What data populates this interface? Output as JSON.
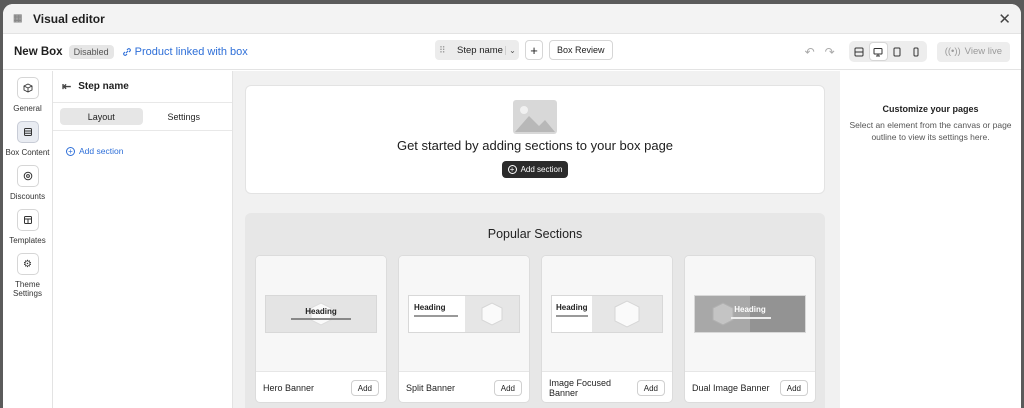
{
  "window": {
    "title": "Visual editor"
  },
  "toolbar": {
    "box_name": "New Box",
    "status_badge": "Disabled",
    "product_link": "Product linked with box",
    "step_select": "Step name",
    "box_review": "Box Review",
    "view_live": "View live"
  },
  "rail": [
    {
      "label": "General",
      "icon": "box-icon"
    },
    {
      "label": "Box Content",
      "icon": "layers-icon",
      "active": true
    },
    {
      "label": "Discounts",
      "icon": "discount-icon"
    },
    {
      "label": "Templates",
      "icon": "template-icon"
    },
    {
      "label": "Theme Settings",
      "icon": "gear-icon"
    }
  ],
  "left_panel": {
    "title": "Step name",
    "tabs": [
      "Layout",
      "Settings"
    ],
    "add_section": "Add section"
  },
  "canvas": {
    "empty_title": "Get started by adding sections to your box page",
    "empty_button": "Add section",
    "popular_title": "Popular Sections",
    "cards": [
      {
        "name": "Hero Banner",
        "add": "Add",
        "heading": "Heading"
      },
      {
        "name": "Split Banner",
        "add": "Add",
        "heading": "Heading"
      },
      {
        "name": "Image Focused Banner",
        "add": "Add",
        "heading": "Heading"
      },
      {
        "name": "Dual Image Banner",
        "add": "Add",
        "heading": "Heading"
      }
    ]
  },
  "right_panel": {
    "title": "Customize your pages",
    "description": "Select an element from the canvas or page outline to view its settings here."
  }
}
